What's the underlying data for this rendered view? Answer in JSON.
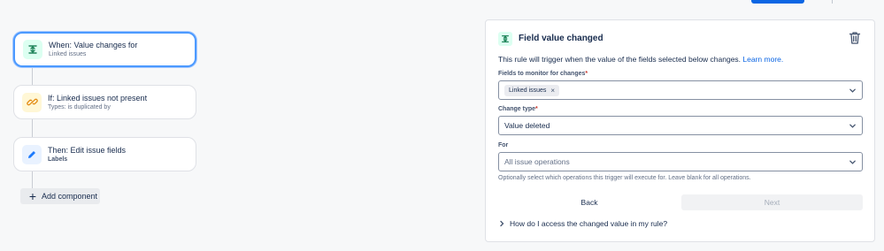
{
  "flow": {
    "trigger": {
      "title": "When: Value changes for",
      "subtitle": "Linked issues",
      "icon": "text-cursor-icon",
      "color": "#1f845a",
      "bg": "#dcfff1"
    },
    "condition": {
      "title": "If: Linked issues not present",
      "subtitle": "Types: is duplicated by",
      "icon": "link-icon",
      "color": "#e2890f",
      "bg": "#fff7d6"
    },
    "action": {
      "title": "Then: Edit issue fields",
      "subtitle": "Labels",
      "icon": "pencil-icon",
      "color": "#1d7afc",
      "bg": "#e9f2ff"
    },
    "add_component_label": "Add component"
  },
  "panel": {
    "title": "Field value changed",
    "description": "This rule will trigger when the value of the fields selected below changes.",
    "learn_more": "Learn more.",
    "fields_label": "Fields to monitor for changes",
    "fields_tag": "Linked issues",
    "change_type_label": "Change type",
    "change_type_value": "Value deleted",
    "for_label": "For",
    "for_placeholder": "All issue operations",
    "hint": "Optionally select which operations this trigger will execute for. Leave blank for all operations.",
    "back_label": "Back",
    "next_label": "Next",
    "expander_label": "How do I access the changed value in my rule?",
    "required_mark": "*"
  }
}
